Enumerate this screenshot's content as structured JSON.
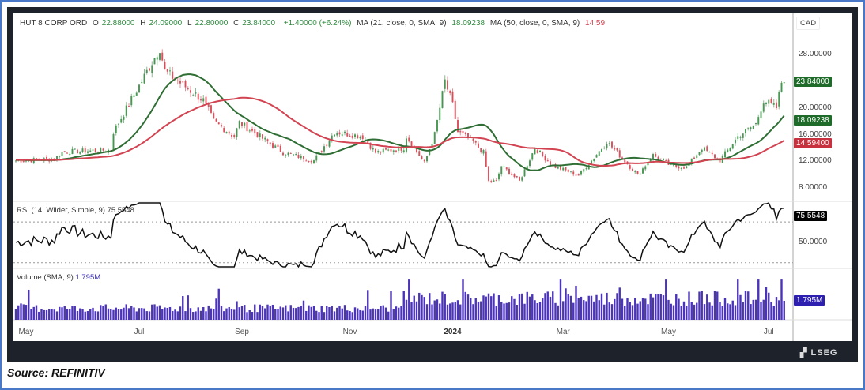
{
  "legend": {
    "symbol": "HUT 8 CORP ORD",
    "open_label": "O",
    "open": "22.88000",
    "high_label": "H",
    "high": "24.09000",
    "low_label": "L",
    "low": "22.80000",
    "close_label": "C",
    "close": "23.84000",
    "change": "+1.40000 (+6.24%)",
    "ma21_label": "MA (21, close, 0, SMA, 9)",
    "ma21_value": "18.09238",
    "ma50_label": "MA (50, close, 0, SMA, 9)",
    "ma50_value": "14.59"
  },
  "currency": "CAD",
  "rsi_label": "RSI (14, Wilder, Simple, 9)",
  "rsi_value": "75.5548",
  "volume_label": "Volume (SMA, 9)",
  "volume_value": "1.795M",
  "price_tags": {
    "last": "23.84000",
    "ma21": "18.09238",
    "ma50": "14.59400"
  },
  "rsi_tag": "75.5548",
  "volume_tag": "1.795M",
  "watermark": "LSEG",
  "source": "Source: REFINITIV",
  "colors": {
    "up": "#3a8f45",
    "down": "#d6424f",
    "ma21": "#2f6e34",
    "ma50": "#d24452",
    "volume": "#4b34b8",
    "rsi": "#111111"
  },
  "chart_data": {
    "type": "candlestick",
    "title": "HUT 8 CORP ORD",
    "bar_count": 300,
    "close_keypoints": [
      [
        0,
        12.1
      ],
      [
        15,
        12.3
      ],
      [
        18,
        13.4
      ],
      [
        37,
        13.7
      ],
      [
        38,
        16.4
      ],
      [
        49,
        24
      ],
      [
        56,
        29
      ],
      [
        58,
        25.5
      ],
      [
        73,
        21.1
      ],
      [
        77,
        18
      ],
      [
        85,
        15.7
      ],
      [
        87,
        17.8
      ],
      [
        104,
        13.3
      ],
      [
        116,
        12.1
      ],
      [
        124,
        16.4
      ],
      [
        135,
        15.7
      ],
      [
        140,
        13.3
      ],
      [
        152,
        15.7
      ],
      [
        151,
        14
      ],
      [
        159,
        11.7
      ],
      [
        163,
        16
      ],
      [
        167,
        24
      ],
      [
        170,
        20.4
      ],
      [
        172,
        16.4
      ],
      [
        178,
        14.9
      ],
      [
        182,
        13.3
      ],
      [
        184,
        9
      ],
      [
        187,
        9
      ],
      [
        189,
        11.3
      ],
      [
        196,
        9
      ],
      [
        202,
        14
      ],
      [
        209,
        11.3
      ],
      [
        219,
        9.9
      ],
      [
        224,
        12.1
      ],
      [
        230,
        14.9
      ],
      [
        234,
        13.3
      ],
      [
        242,
        9.9
      ],
      [
        248,
        12.9
      ],
      [
        255,
        11.3
      ],
      [
        261,
        11.1
      ],
      [
        267,
        14
      ],
      [
        274,
        12.1
      ],
      [
        281,
        15.7
      ],
      [
        288,
        17.6
      ],
      [
        291,
        21.1
      ],
      [
        296,
        20
      ],
      [
        298,
        23.84
      ]
    ],
    "ma_periods": [
      21,
      50
    ],
    "price_axis": {
      "ticks": [
        "28.00000",
        "20.00000",
        "16.00000",
        "12.00000",
        "8.00000"
      ],
      "tick_values": [
        28,
        20,
        16,
        12,
        8
      ],
      "range": [
        4.5,
        34.5
      ]
    },
    "rsi_axis": {
      "ticks": [
        "50.0000"
      ],
      "tick_values": [
        50
      ],
      "levels": [
        70,
        30
      ]
    },
    "volume_axis": {
      "unit": "M",
      "last": 1.795,
      "max": 4.0
    },
    "time_ticks": [
      {
        "label": "May",
        "bar": 4,
        "bold": false
      },
      {
        "label": "Jul",
        "bar": 48,
        "bold": false
      },
      {
        "label": "Sep",
        "bar": 88,
        "bold": false
      },
      {
        "label": "Nov",
        "bar": 130,
        "bold": false
      },
      {
        "label": "2024",
        "bar": 170,
        "bold": true
      },
      {
        "label": "Mar",
        "bar": 213,
        "bold": false
      },
      {
        "label": "May",
        "bar": 254,
        "bold": false
      },
      {
        "label": "Jul",
        "bar": 293,
        "bold": false
      }
    ]
  }
}
